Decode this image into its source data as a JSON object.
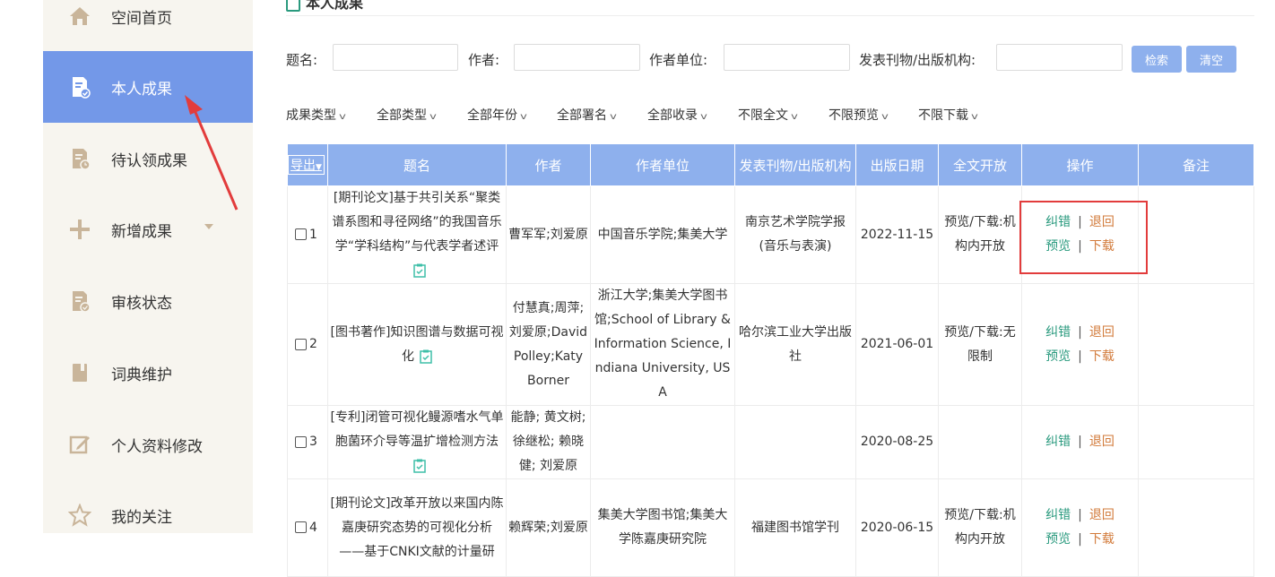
{
  "sidebar": {
    "items": [
      {
        "label": "空间首页",
        "icon": "home-icon"
      },
      {
        "label": "本人成果",
        "icon": "document-check-icon"
      },
      {
        "label": "待认领成果",
        "icon": "document-clock-icon"
      },
      {
        "label": "新增成果",
        "icon": "plus-icon"
      },
      {
        "label": "审核状态",
        "icon": "document-status-icon"
      },
      {
        "label": "词典维护",
        "icon": "book-icon"
      },
      {
        "label": "个人资料修改",
        "icon": "edit-icon"
      },
      {
        "label": "我的关注",
        "icon": "star-icon"
      }
    ]
  },
  "main": {
    "section_title": "本人成果"
  },
  "search": {
    "title_label": "题名:",
    "author_label": "作者:",
    "affiliation_label": "作者单位:",
    "publication_label": "发表刊物/出版机构:",
    "search_button": "检索",
    "clear_button": "清空"
  },
  "filters": [
    "成果类型",
    "全部类型",
    "全部年份",
    "全部署名",
    "全部收录",
    "不限全文",
    "不限预览",
    "不限下载"
  ],
  "table": {
    "export_label": "导出",
    "headers": [
      "题名",
      "作者",
      "作者单位",
      "发表刊物/出版机构",
      "出版日期",
      "全文开放",
      "操作",
      "备注"
    ],
    "rows": [
      {
        "index": "1",
        "title": "[期刊论文]基于共引关系“聚类谱系图和寻径网络”的我国音乐学“学科结构”与代表学者述评",
        "authors": "曹军军;刘爱原",
        "affiliation": "中国音乐学院;集美大学",
        "publication": "南京艺术学院学报(音乐与表演)",
        "date": "2022-11-15",
        "open_access": "预览/下载:机构内开放",
        "ops": {
          "correct": "纠错",
          "return": "退回",
          "preview": "预览",
          "download": "下载"
        },
        "note": ""
      },
      {
        "index": "2",
        "title": "[图书著作]知识图谱与数据可视化",
        "authors": "付慧真;周萍;刘爱原;David Polley;Katy Borner",
        "affiliation": "浙江大学;集美大学图书馆;School of Library & Information Science, Indiana University, USA",
        "publication": "哈尔滨工业大学出版社",
        "date": "2021-06-01",
        "open_access": "预览/下载:无限制",
        "ops": {
          "correct": "纠错",
          "return": "退回",
          "preview": "预览",
          "download": "下载"
        },
        "note": ""
      },
      {
        "index": "3",
        "title": "[专利]闭管可视化鳗源嗜水气单胞菌环介导等温扩增检测方法",
        "authors": "能静; 黄文树; 徐继松; 赖晓健; 刘爱原",
        "affiliation": "",
        "publication": "",
        "date": "2020-08-25",
        "open_access": "",
        "ops": {
          "correct": "纠错",
          "return": "退回",
          "preview": "",
          "download": ""
        },
        "note": ""
      },
      {
        "index": "4",
        "title": "[期刊论文]改革开放以来国内陈嘉庚研究态势的可视化分析——基于CNKI文献的计量研",
        "authors": "赖辉荣;刘爱原",
        "affiliation": "集美大学图书馆;集美大学陈嘉庚研究院",
        "publication": "福建图书馆学刊",
        "date": "2020-06-15",
        "open_access": "预览/下载:机构内开放",
        "ops": {
          "correct": "纠错",
          "return": "退回",
          "preview": "预览",
          "download": "下载"
        },
        "note": ""
      }
    ]
  },
  "colors": {
    "sidebar_active": "#7398e8",
    "header_blue": "#8eb0ed",
    "op_green": "#2a9a7e",
    "op_orange": "#d27a3a",
    "annotation_red": "#e23c3c",
    "icon_tan": "#c9b59a"
  }
}
